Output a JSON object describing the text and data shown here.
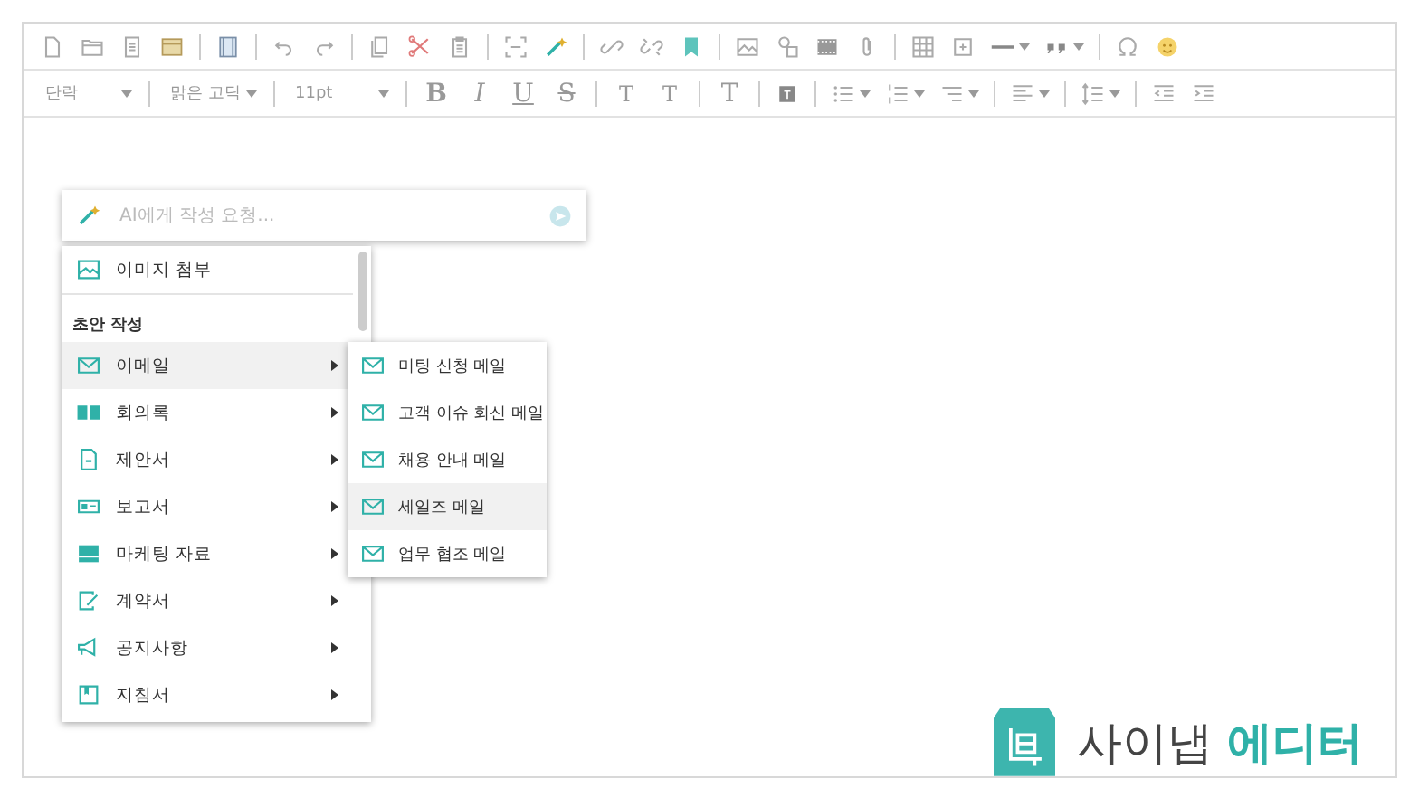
{
  "toolbar": {
    "style_dropdowns": [
      {
        "kind": "paragraph",
        "value": "단락"
      },
      {
        "kind": "font",
        "value": "맑은 고딕"
      },
      {
        "kind": "size",
        "value": "11pt"
      }
    ],
    "format_buttons": [
      {
        "kind": "bold",
        "label": "B"
      },
      {
        "kind": "italic",
        "label": "I"
      },
      {
        "kind": "underline",
        "label": "U"
      },
      {
        "kind": "strike",
        "label": "S"
      },
      {
        "kind": "superscript",
        "label": "T"
      },
      {
        "kind": "subscript",
        "label": "T"
      },
      {
        "kind": "clear",
        "label": "T"
      }
    ]
  },
  "ai_panel": {
    "placeholder": "AI에게 작성 요청...",
    "attach_item": {
      "label": "이미지 첨부"
    },
    "section_title": "초안 작성",
    "items": [
      {
        "kind": "email",
        "label": "이메일",
        "selected": true
      },
      {
        "kind": "minutes",
        "label": "회의록",
        "selected": false
      },
      {
        "kind": "proposal",
        "label": "제안서",
        "selected": false
      },
      {
        "kind": "report",
        "label": "보고서",
        "selected": false
      },
      {
        "kind": "marketing",
        "label": "마케팅 자료",
        "selected": false
      },
      {
        "kind": "contract",
        "label": "계약서",
        "selected": false
      },
      {
        "kind": "notice",
        "label": "공지사항",
        "selected": false
      },
      {
        "kind": "guide",
        "label": "지침서",
        "selected": false
      }
    ],
    "submenu": [
      {
        "label": "미팅 신청 메일",
        "selected": false
      },
      {
        "label": "고객 이슈 회신 메일",
        "selected": false
      },
      {
        "label": "채용 안내 메일",
        "selected": false
      },
      {
        "label": "세일즈 메일",
        "selected": true
      },
      {
        "label": "업무 협조 메일",
        "selected": false
      }
    ]
  },
  "logo": {
    "brand": "사이냅",
    "product": "에디터"
  }
}
